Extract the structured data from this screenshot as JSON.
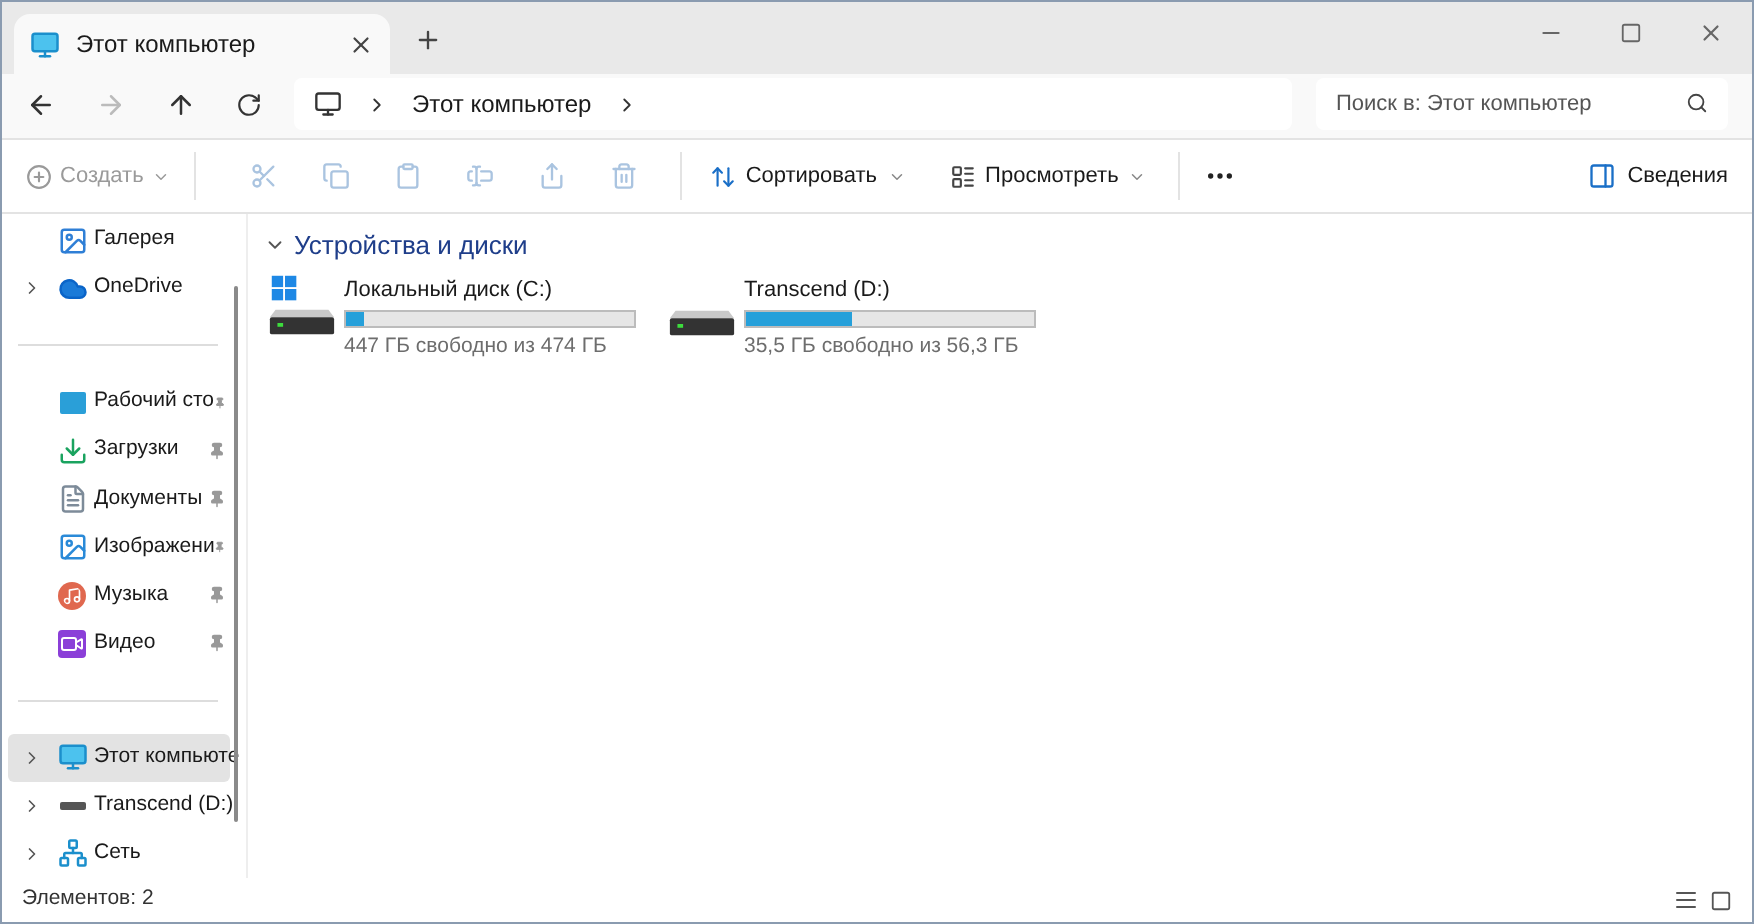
{
  "tab": {
    "title": "Этот компьютер"
  },
  "address": {
    "crumbs": [
      "Этот компьютер"
    ]
  },
  "search": {
    "placeholder": "Поиск в: Этот компьютер"
  },
  "toolbar": {
    "create": {
      "label": "Создать",
      "disabled": true
    },
    "actions": [
      {
        "kind": "cut",
        "disabled": true
      },
      {
        "kind": "copy",
        "disabled": true
      },
      {
        "kind": "paste",
        "disabled": true
      },
      {
        "kind": "rename",
        "disabled": true
      },
      {
        "kind": "share",
        "disabled": true
      },
      {
        "kind": "delete",
        "disabled": true
      }
    ],
    "sort": "Сортировать",
    "view": "Просмотреть",
    "details": "Сведения"
  },
  "sidebar": {
    "items": [
      {
        "kind": "gallery",
        "label": "Галерея",
        "expandable": false,
        "pinned": false,
        "selected": false
      },
      {
        "kind": "cloud",
        "label": "OneDrive",
        "expandable": true,
        "pinned": false,
        "selected": false
      },
      {
        "kind": "divider"
      },
      {
        "kind": "desktop",
        "label": "Рабочий сто",
        "expandable": false,
        "pinned": true,
        "selected": false
      },
      {
        "kind": "downloads",
        "label": "Загрузки",
        "expandable": false,
        "pinned": true,
        "selected": false
      },
      {
        "kind": "documents",
        "label": "Документы",
        "expandable": false,
        "pinned": true,
        "selected": false
      },
      {
        "kind": "pictures",
        "label": "Изображени",
        "expandable": false,
        "pinned": true,
        "selected": false
      },
      {
        "kind": "music",
        "label": "Музыка",
        "expandable": false,
        "pinned": true,
        "selected": false
      },
      {
        "kind": "video",
        "label": "Видео",
        "expandable": false,
        "pinned": true,
        "selected": false
      },
      {
        "kind": "divider"
      },
      {
        "kind": "computer",
        "label": "Этот компьюте",
        "expandable": true,
        "pinned": false,
        "selected": true
      },
      {
        "kind": "drive",
        "label": "Transcend (D:)",
        "expandable": true,
        "pinned": false,
        "selected": false
      },
      {
        "kind": "network",
        "label": "Сеть",
        "expandable": true,
        "pinned": false,
        "selected": false
      }
    ]
  },
  "section": {
    "title": "Устройства и диски",
    "expanded": true,
    "drives": [
      {
        "kind": "system",
        "name": "Локальный диск (C:)",
        "level": 0.06,
        "free": "447 ГБ свободно из 474 ГБ"
      },
      {
        "kind": "removable",
        "name": "Transcend (D:)",
        "level": 0.37,
        "free": "35,5 ГБ свободно из 56,3 ГБ"
      }
    ]
  },
  "status_bar": {
    "count": "Элементов: 2"
  }
}
